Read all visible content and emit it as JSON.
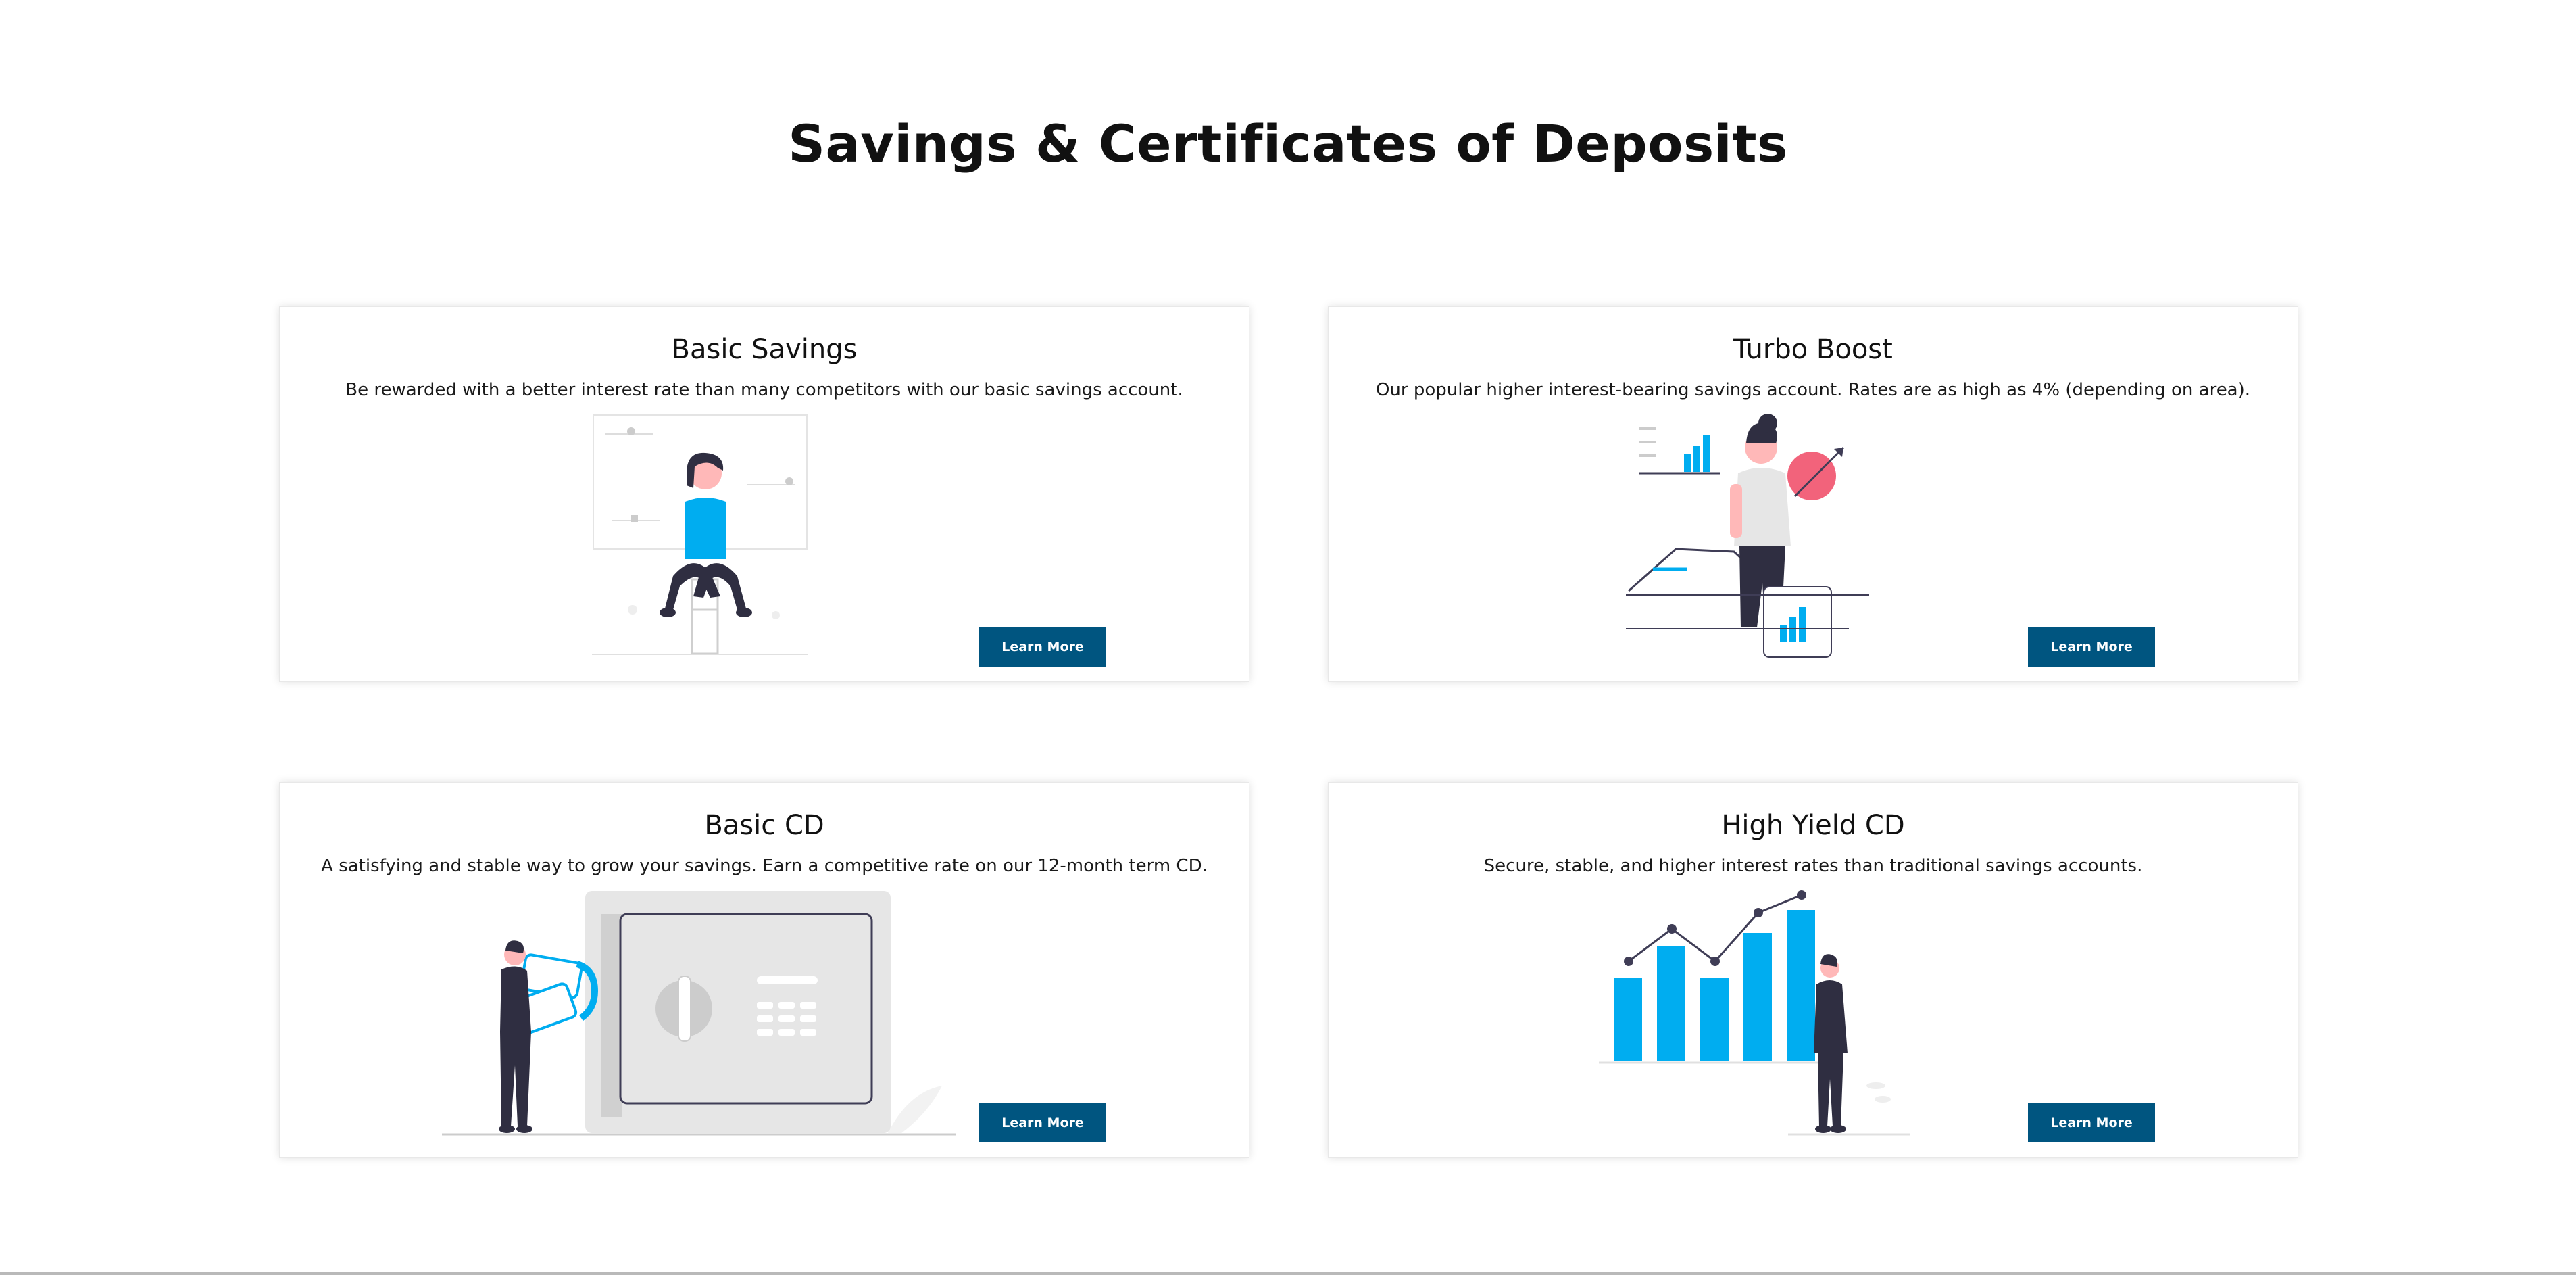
{
  "page": {
    "title": "Savings & Certificates of Deposits"
  },
  "cards": [
    {
      "title": "Basic Savings",
      "description": "Be rewarded with a better interest rate than many competitors with our basic savings account.",
      "button_label": "Learn More",
      "illustration": "person-on-stool-illustration"
    },
    {
      "title": "Turbo Boost",
      "description": "Our popular higher interest-bearing savings account. Rates are as high as 4% (depending on area).",
      "button_label": "Learn More",
      "illustration": "woman-growth-chart-illustration"
    },
    {
      "title": "Basic CD",
      "description": "A satisfying and stable way to grow your savings. Earn a competitive rate on our 12-month term CD.",
      "button_label": "Learn More",
      "illustration": "man-at-safe-illustration"
    },
    {
      "title": "High Yield CD",
      "description": "Secure, stable, and higher interest rates than traditional savings accounts.",
      "button_label": "Learn More",
      "illustration": "man-bar-chart-illustration"
    }
  ],
  "colors": {
    "accent_blue": "#00adf0",
    "button_bg": "#005580",
    "dark_figure": "#2f2e41",
    "pink": "#f2637b"
  }
}
